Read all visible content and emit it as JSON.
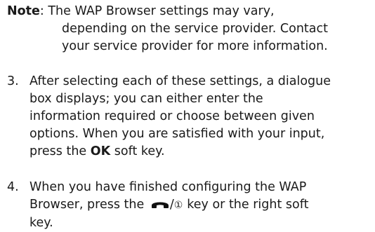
{
  "note": {
    "label": "Note",
    "lines": [
      ": The WAP Browser settings may vary,",
      "depending on the service provider. Contact",
      "your service provider for more information."
    ]
  },
  "step3": {
    "number": "3.",
    "lines": [
      "After selecting each of these settings, a dialogue",
      "box displays; you can either enter the",
      "information required or choose between given",
      "options. When you are satisfied with your input,"
    ],
    "last_prefix": "press the ",
    "ok_key": "OK",
    "last_suffix": " soft key."
  },
  "step4": {
    "number": "4.",
    "line1": "When you have finished configuring the WAP",
    "line2_prefix": "Browser, press the ",
    "slash": "/",
    "power_symbol": "①",
    "line2_suffix": "key or the right soft",
    "line3": "key.",
    "end_key_icon": "end-call-handset-icon"
  }
}
